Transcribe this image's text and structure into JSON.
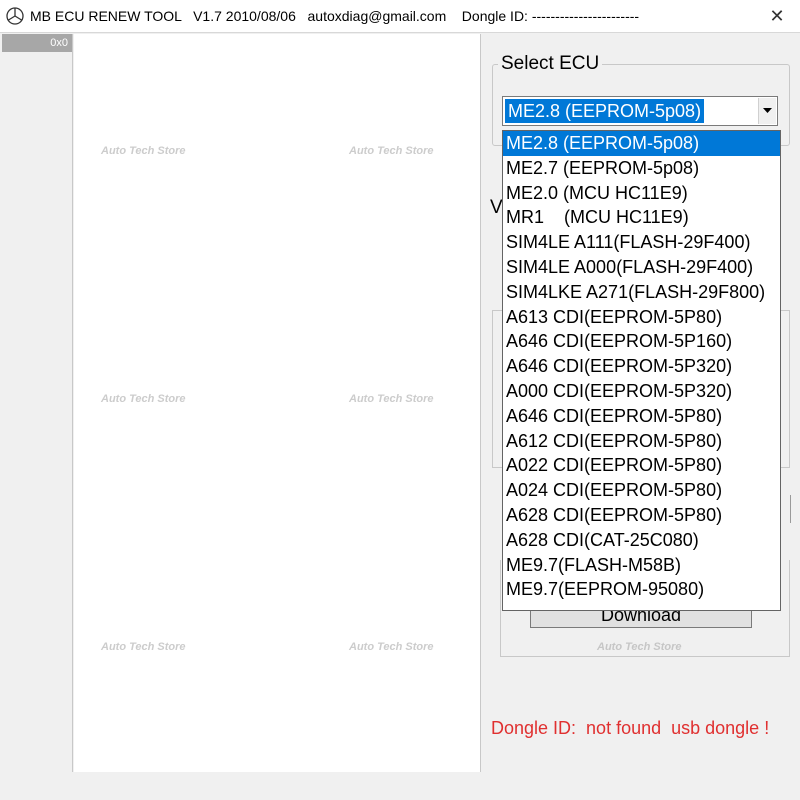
{
  "window": {
    "title": "MB ECU RENEW TOOL   V1.7 2010/08/06   autoxdiag@gmail.com    Dongle ID: -----------------------",
    "close_glyph": "✕"
  },
  "left_panel": {
    "address": "0x0"
  },
  "watermark": {
    "text": "Auto Tech Store"
  },
  "select_ecu": {
    "legend": "Select ECU",
    "selected": "ME2.8 (EEPROM-5p08)",
    "options": [
      "ME2.8 (EEPROM-5p08)",
      "ME2.7 (EEPROM-5p08)",
      "ME2.0 (MCU HC11E9)",
      "MR1    (MCU HC11E9)",
      "SIM4LE A111(FLASH-29F400)",
      "SIM4LE A000(FLASH-29F400)",
      "SIM4LKE A271(FLASH-29F800)",
      "A613 CDI(EEPROM-5P80)",
      "A646 CDI(EEPROM-5P160)",
      "A646 CDI(EEPROM-5P320)",
      "A000 CDI(EEPROM-5P320)",
      "A646 CDI(EEPROM-5P80)",
      "A612 CDI(EEPROM-5P80)",
      "A022 CDI(EEPROM-5P80)",
      "A024 CDI(EEPROM-5P80)",
      "A628 CDI(EEPROM-5P80)",
      "A628 CDI(CAT-25C080)",
      "ME9.7(FLASH-M58B)",
      "ME9.7(EEPROM-95080)"
    ]
  },
  "hidden_label_fragment": "V",
  "download_button": {
    "label": "Download"
  },
  "status": {
    "dongle": "Dongle ID:  not found  usb dongle !",
    "color": "#e03030"
  },
  "colors": {
    "selection": "#0078d7",
    "window_bg": "#f0f0f0"
  }
}
